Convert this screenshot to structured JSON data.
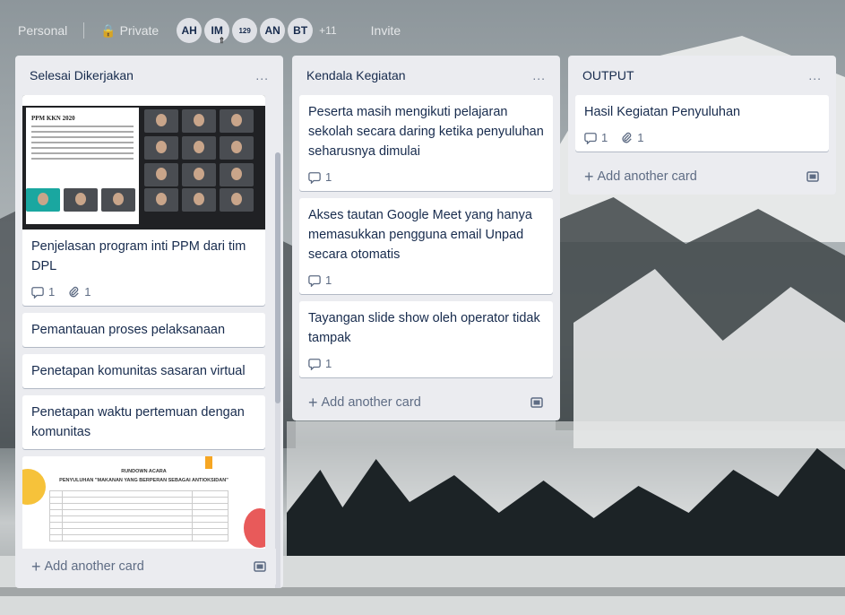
{
  "board": {
    "visibility_team": "Personal",
    "visibility_privacy": "Private",
    "members": [
      {
        "initials": "AH"
      },
      {
        "initials": "IM"
      },
      {
        "initials": "129"
      },
      {
        "initials": "AN"
      },
      {
        "initials": "BT"
      }
    ],
    "more_members": "+11",
    "invite_label": "Invite"
  },
  "lists": [
    {
      "title": "Selesai Dikerjakan",
      "menu": "...",
      "cards": [
        {
          "title": "Penjelasan program inti PPM dari tim DPL",
          "comments": "1",
          "attachments": "1",
          "cover": "meet"
        },
        {
          "title": "Pemantauan proses pelaksanaan"
        },
        {
          "title": "Penetapan komunitas sasaran virtual"
        },
        {
          "title": "Penetapan waktu pertemuan dengan komunitas"
        },
        {
          "cover": "schedule"
        }
      ],
      "cover_meet_slide_title": "PPM KKN 2020",
      "cover_schedule_title": "RUNDOWN ACARA",
      "cover_schedule_subtitle": "PENYULUHAN \"MAKANAN YANG BERPERAN SEBAGAI ANTIOKSIDAN\"",
      "add_label": "Add another card"
    },
    {
      "title": "Kendala Kegiatan",
      "menu": "...",
      "cards": [
        {
          "title": "Peserta masih mengikuti pelajaran sekolah secara daring ketika penyuluhan seharusnya dimulai",
          "comments": "1"
        },
        {
          "title": "Akses tautan Google Meet yang hanya memasukkan pengguna email Unpad secara otomatis",
          "comments": "1"
        },
        {
          "title": "Tayangan slide show oleh operator tidak tampak",
          "comments": "1"
        }
      ],
      "add_label": "Add another card"
    },
    {
      "title": "OUTPUT",
      "menu": "...",
      "cards": [
        {
          "title": "Hasil Kegiatan Penyuluhan",
          "comments": "1",
          "attachments": "1"
        }
      ],
      "add_label": "Add another card"
    }
  ],
  "colors": {
    "list_bg": "#ebecf0",
    "card_text": "#172b4d",
    "muted": "#5e6c84"
  }
}
